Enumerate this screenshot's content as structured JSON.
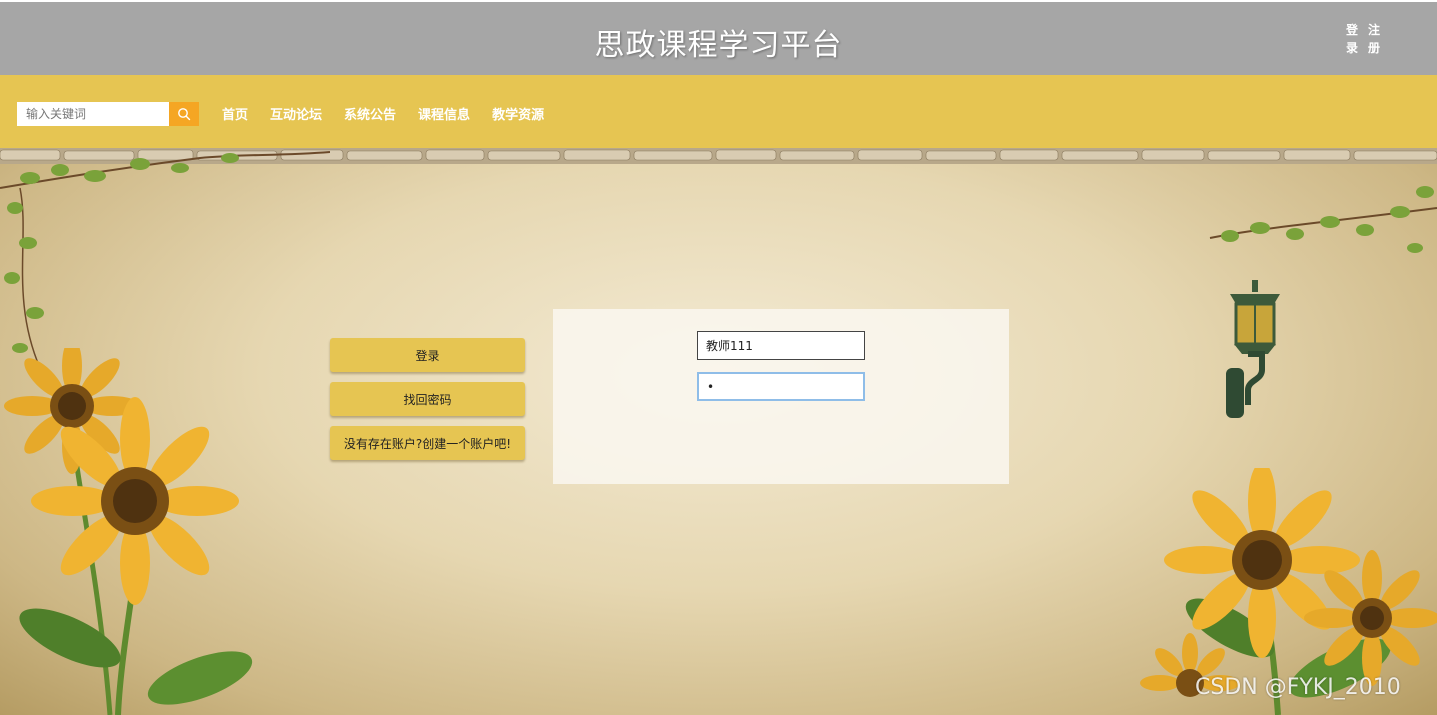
{
  "header": {
    "title": "思政课程学习平台",
    "auth_links": [
      "登",
      "注",
      "录",
      "册"
    ]
  },
  "search": {
    "placeholder": "输入关键词",
    "icon": "search-icon"
  },
  "nav": {
    "items": [
      "首页",
      "互动论坛",
      "系统公告",
      "课程信息",
      "教学资源"
    ]
  },
  "login": {
    "buttons": {
      "login": "登录",
      "recover": "找回密码",
      "register": "没有存在账户?创建一个账户吧!"
    },
    "username_value": "教师111",
    "password_value": "•"
  },
  "watermark": "CSDN @FYKJ_2010",
  "colors": {
    "header_bg": "#a6a6a6",
    "nav_bg": "#e6c552",
    "search_button": "#f5a623",
    "button_bg": "#e6c552"
  }
}
